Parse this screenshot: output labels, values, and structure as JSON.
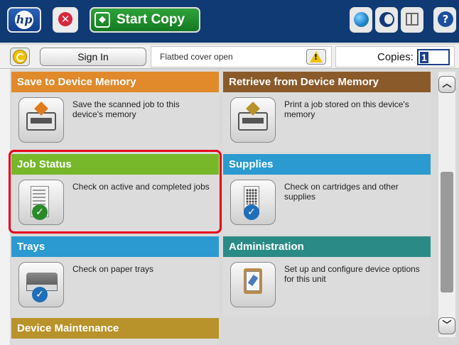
{
  "topbar": {
    "home_icon": "hp-logo-icon",
    "hp_logo": "hp",
    "stop_icon": "stop-icon",
    "start_copy_label": "Start Copy",
    "icons": [
      "globe-icon",
      "sleep-icon",
      "network-icon",
      "help-icon"
    ]
  },
  "statusbar": {
    "reset_icon": "reset-icon",
    "sign_in_label": "Sign In",
    "status_message": "Flatbed cover open",
    "warning_icon": "warning-icon",
    "copies_label": "Copies:",
    "copies_value": "1"
  },
  "tiles": [
    {
      "title": "Save to Device Memory",
      "desc": "Save the scanned job to this device's memory",
      "color": "#e08a2b",
      "icon": "save-to-memory-icon"
    },
    {
      "title": "Retrieve from Device Memory",
      "desc": "Print a job stored on this device's memory",
      "color": "#8a5a2a",
      "icon": "retrieve-from-memory-icon"
    },
    {
      "title": "Job Status",
      "desc": "Check on active and completed jobs",
      "color": "#76b82a",
      "icon": "job-status-icon"
    },
    {
      "title": "Supplies",
      "desc": "Check on cartridges and other supplies",
      "color": "#2a9ad0",
      "icon": "supplies-icon"
    },
    {
      "title": "Trays",
      "desc": "Check on paper trays",
      "color": "#2a9ad0",
      "icon": "trays-icon"
    },
    {
      "title": "Administration",
      "desc": "Set up and configure device options for this unit",
      "color": "#2a8a86",
      "icon": "administration-icon"
    },
    {
      "title": "Device Maintenance",
      "desc": "",
      "color": "#b8922a",
      "icon": ""
    }
  ],
  "highlight_color": "#e3001b",
  "scroll": {
    "up_icon": "scroll-up-icon",
    "down_icon": "scroll-down-icon"
  }
}
